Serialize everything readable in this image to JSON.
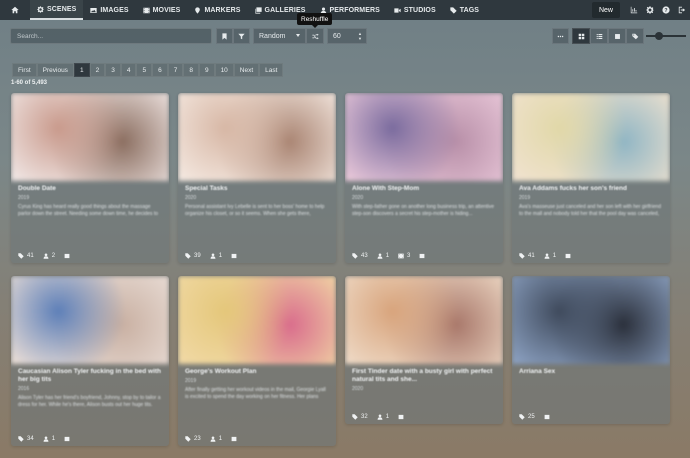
{
  "nav": {
    "items": [
      {
        "label": "Scenes",
        "icon": "gear-icon",
        "active": true
      },
      {
        "label": "Images",
        "icon": "image-icon",
        "active": false
      },
      {
        "label": "Movies",
        "icon": "film-icon",
        "active": false
      },
      {
        "label": "Markers",
        "icon": "map-marker-icon",
        "active": false
      },
      {
        "label": "Galleries",
        "icon": "images-icon",
        "active": false
      },
      {
        "label": "Performers",
        "icon": "user-icon",
        "active": false
      },
      {
        "label": "Studios",
        "icon": "video-icon",
        "active": false
      },
      {
        "label": "Tags",
        "icon": "tag-icon",
        "active": false
      }
    ],
    "new_label": "New"
  },
  "tooltip": "Reshuffle",
  "toolbar": {
    "search_placeholder": "Search...",
    "sort_label": "Random",
    "per_page": "60"
  },
  "pagination": {
    "first": "First",
    "previous": "Previous",
    "pages": [
      "1",
      "2",
      "3",
      "4",
      "5",
      "6",
      "7",
      "8",
      "9",
      "10"
    ],
    "active_page": "1",
    "next": "Next",
    "last": "Last"
  },
  "result_count": "1-60 of 5,493",
  "scenes": [
    {
      "title": "Double Date",
      "date": "2019",
      "desc": "Cyrus King has heard really good things about the massage parlor down the street. Needing some down time, he decides to walk down...",
      "tags": "41",
      "performers": "2",
      "extra": null,
      "colors": [
        "#c99a8c",
        "#f0e6e4",
        "#8a6d5f"
      ]
    },
    {
      "title": "Special Tasks",
      "date": "2020",
      "desc": "Personal assistant Ivy Lebelle is sent to her boss' home to help organize his closet, or so it seems. When she gets there, however, she...",
      "tags": "39",
      "performers": "1",
      "extra": null,
      "colors": [
        "#d7b7a5",
        "#f4e8e0",
        "#a98472"
      ]
    },
    {
      "title": "Alone With Step-Mom",
      "date": "2020",
      "desc": "With step-father gone on another long business trip, an attentive step-son discovers a secret his step-mother is hiding...",
      "tags": "43",
      "performers": "1",
      "extra": "3",
      "colors": [
        "#7a6b9e",
        "#e9c8d9",
        "#b88fa8"
      ]
    },
    {
      "title": "Ava Addams fucks her son's friend",
      "date": "2019",
      "desc": "Ava's masseuse just canceled and her son left with her girlfriend to the mall and nobody told her that the pool day was canceled, so...",
      "tags": "41",
      "performers": "1",
      "extra": null,
      "colors": [
        "#e1d8a8",
        "#f0e2cf",
        "#8fb5c4"
      ]
    },
    {
      "title": "Caucasian Alison Tyler fucking in the bed with her big tits",
      "date": "2016",
      "desc": "Alison Tyler has her friend's boyfriend, Johnny, stop by to tailor a dress for her. While he's there, Alison busts out her huge tits. Johnny...",
      "tags": "34",
      "performers": "1",
      "extra": null,
      "colors": [
        "#5d7fb8",
        "#e9ddd6",
        "#c9b0a2"
      ]
    },
    {
      "title": "George's Workout Plan",
      "date": "2019",
      "desc": "After finally getting her workout videos in the mail, Georgie Lyall is excited to spend the day working on her fitness. Her plans are...",
      "tags": "23",
      "performers": "1",
      "extra": null,
      "colors": [
        "#e4c77a",
        "#f1d9a5",
        "#d96b8c"
      ]
    },
    {
      "title": "First Tinder date with a busty girl with perfect natural tits and she...",
      "date": "2020",
      "desc": "",
      "tags": "32",
      "performers": "1",
      "extra": null,
      "colors": [
        "#d8a47c",
        "#eed9c5",
        "#a8776a"
      ]
    },
    {
      "title": "Arriana Sex",
      "date": "",
      "desc": "",
      "tags": "25",
      "performers": null,
      "extra": null,
      "colors": [
        "#3f4a5c",
        "#8ba0c0",
        "#2a2f3a"
      ]
    }
  ]
}
